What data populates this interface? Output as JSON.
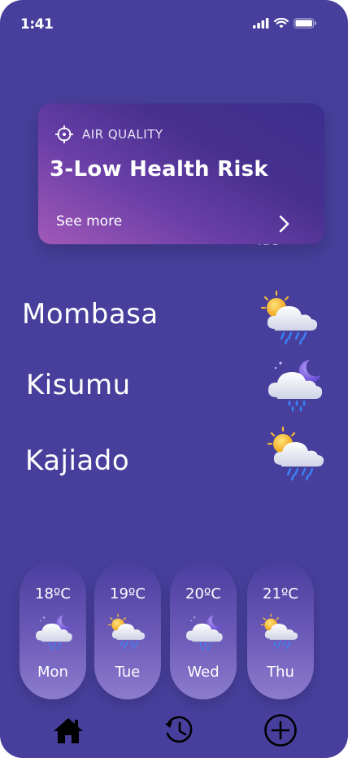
{
  "status": {
    "time": "1:41",
    "icons": [
      "signal-icon",
      "wifi-icon",
      "battery-icon"
    ]
  },
  "air_quality": {
    "icon": "crosshair-icon",
    "title": "AIR QUALITY",
    "value": "3-Low Health Risk",
    "link": "See more",
    "chevron": "chevron-right-icon"
  },
  "partial_day": "Tue",
  "cities": [
    {
      "name": "Mombasa",
      "icon": "sun-cloud-rain-icon"
    },
    {
      "name": "Kisumu",
      "icon": "moon-cloud-rain-icon"
    },
    {
      "name": "Kajiado",
      "icon": "sun-cloud-rain-icon"
    }
  ],
  "forecast": [
    {
      "temp": "18ºC",
      "day": "Mon",
      "icon": "moon-cloud-rain-icon"
    },
    {
      "temp": "19ºC",
      "day": "Tue",
      "icon": "sun-cloud-rain-icon"
    },
    {
      "temp": "20ºC",
      "day": "Wed",
      "icon": "moon-cloud-rain-icon"
    },
    {
      "temp": "21ºC",
      "day": "Thu",
      "icon": "sun-cloud-rain-icon"
    }
  ],
  "nav": [
    "home-icon",
    "history-icon",
    "add-icon"
  ],
  "colors": {
    "background": "#473f9b",
    "card_gradient_start": "#a259b8",
    "card_gradient_end": "#3c2f8f",
    "text": "#ffffff"
  }
}
